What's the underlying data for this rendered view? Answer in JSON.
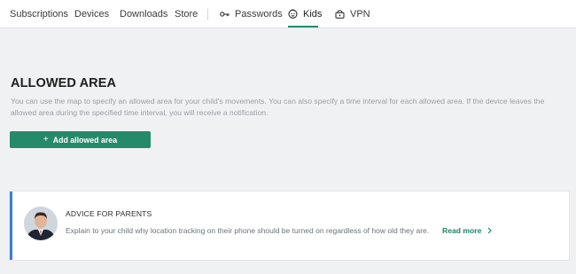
{
  "nav": {
    "items": [
      {
        "label": "Subscriptions"
      },
      {
        "label": "Devices"
      },
      {
        "label": "Downloads"
      },
      {
        "label": "Store"
      },
      {
        "label": "Passwords",
        "icon": "key-icon"
      },
      {
        "label": "Kids",
        "icon": "kids-face-icon",
        "active": true
      },
      {
        "label": "VPN",
        "icon": "vpn-lock-icon"
      }
    ]
  },
  "main": {
    "title": "ALLOWED AREA",
    "description": "You can use the map to specify an allowed area for your child's movements. You can also specify a time interval for each allowed area. If the device leaves the allowed area during the specified time interval, you will receive a notification.",
    "add_button": {
      "icon": "plus-icon",
      "label": "Add allowed area"
    }
  },
  "advice": {
    "title": "ADVICE FOR PARENTS",
    "text": "Explain to your child why location tracking on their phone should be turned on regardless of how old they are.",
    "read_more": "Read more",
    "avatar": "person-photo"
  },
  "colors": {
    "accent_green": "#258a6a",
    "advice_border": "#3b7fd8",
    "background": "#f0f1f3"
  }
}
